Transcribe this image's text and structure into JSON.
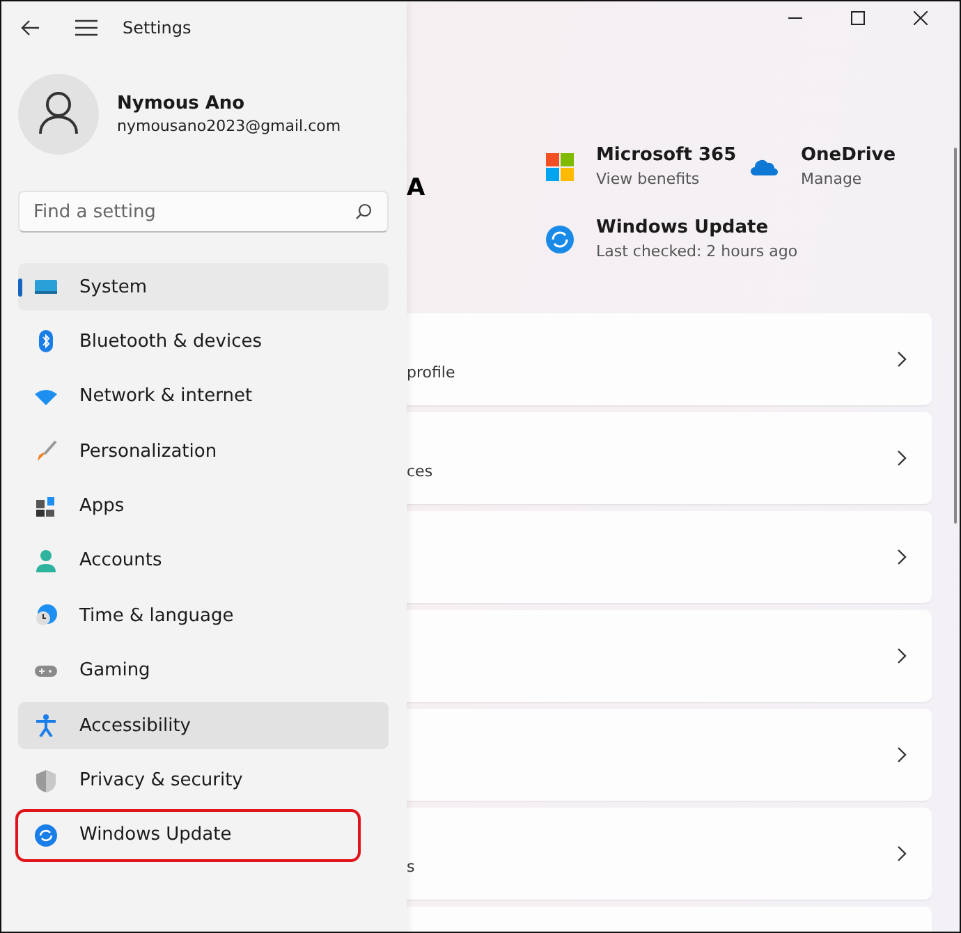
{
  "window": {
    "title": "Settings"
  },
  "account": {
    "name": "Nymous Ano",
    "email": "nymousano2023@gmail.com"
  },
  "search": {
    "placeholder": "Find a setting"
  },
  "nav": [
    {
      "label": "System",
      "kind": "system",
      "selected": true,
      "hovered": false,
      "annotated": false
    },
    {
      "label": "Bluetooth & devices",
      "kind": "bluetooth",
      "selected": false,
      "hovered": false,
      "annotated": false
    },
    {
      "label": "Network & internet",
      "kind": "network",
      "selected": false,
      "hovered": false,
      "annotated": false
    },
    {
      "label": "Personalization",
      "kind": "personalization",
      "selected": false,
      "hovered": false,
      "annotated": false
    },
    {
      "label": "Apps",
      "kind": "apps",
      "selected": false,
      "hovered": false,
      "annotated": false
    },
    {
      "label": "Accounts",
      "kind": "accounts",
      "selected": false,
      "hovered": false,
      "annotated": false
    },
    {
      "label": "Time & language",
      "kind": "time",
      "selected": false,
      "hovered": false,
      "annotated": false
    },
    {
      "label": "Gaming",
      "kind": "gaming",
      "selected": false,
      "hovered": false,
      "annotated": false
    },
    {
      "label": "Accessibility",
      "kind": "accessibility",
      "selected": false,
      "hovered": true,
      "annotated": false
    },
    {
      "label": "Privacy & security",
      "kind": "privacy",
      "selected": false,
      "hovered": false,
      "annotated": false
    },
    {
      "label": "Windows Update",
      "kind": "update",
      "selected": false,
      "hovered": false,
      "annotated": true
    }
  ],
  "content": {
    "heading_fragment": "A",
    "quick_links": [
      {
        "kind": "microsoft365",
        "title": "Microsoft 365",
        "subtitle": "View benefits"
      },
      {
        "kind": "onedrive",
        "title": "OneDrive",
        "subtitle": "Manage"
      },
      {
        "kind": "update",
        "title": "Windows Update",
        "subtitle": "Last checked: 2 hours ago"
      }
    ],
    "cards": [
      {
        "kind": "with_text",
        "partial_text": "profile"
      },
      {
        "kind": "with_text",
        "partial_text": "ces"
      },
      {
        "kind": "plain"
      },
      {
        "kind": "plain"
      },
      {
        "kind": "plain"
      },
      {
        "kind": "with_text",
        "partial_text": "s"
      },
      {
        "kind": "cut_off"
      }
    ]
  }
}
